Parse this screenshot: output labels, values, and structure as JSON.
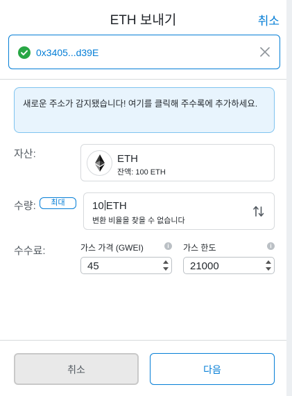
{
  "header": {
    "title": "ETH 보내기",
    "cancel_label": "취소"
  },
  "recipient": {
    "address": "0x3405...d39E"
  },
  "notice": {
    "text": "새로운 주소가 감지됐습니다! 여기를 클릭해 주수록에 추가하세요."
  },
  "asset": {
    "label": "자산:",
    "name": "ETH",
    "balance": "잔액: 100 ETH"
  },
  "amount": {
    "label": "수량:",
    "max_label": "최대",
    "value": "10",
    "unit": "ETH",
    "conversion_note": "변환 비율을 찾을 수 없습니다"
  },
  "fee": {
    "label": "수수료:",
    "gas_price": {
      "label": "가스 가격 (GWEI)",
      "value": "45"
    },
    "gas_limit": {
      "label": "가스 한도",
      "value": "21000"
    }
  },
  "footer": {
    "cancel_label": "취소",
    "next_label": "다음"
  },
  "colors": {
    "accent": "#037dd6",
    "success": "#28a745"
  }
}
